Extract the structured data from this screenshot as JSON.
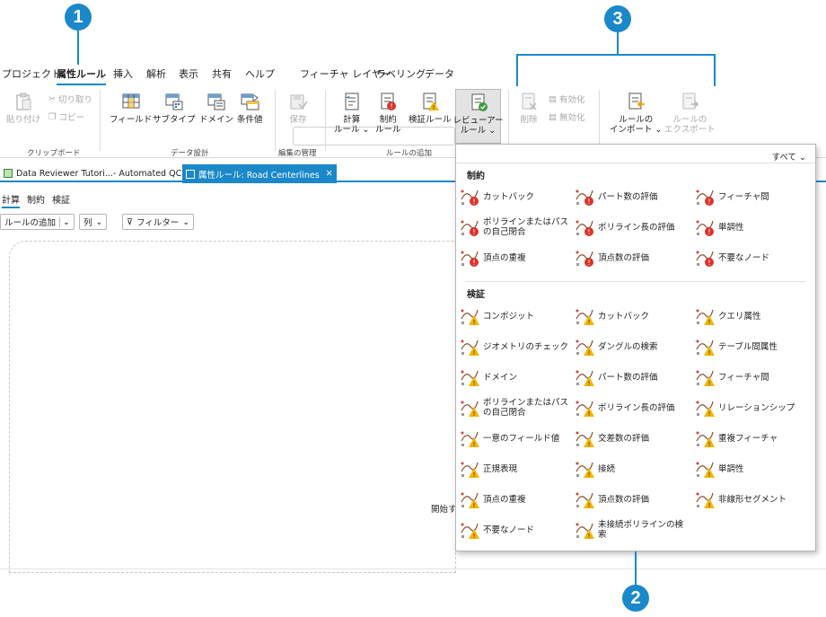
{
  "callouts": [
    "1",
    "2",
    "3"
  ],
  "menu": {
    "items": [
      "プロジェクト",
      "属性ルール",
      "挿入",
      "解析",
      "表示",
      "共有",
      "ヘルプ"
    ],
    "contextual": [
      "フィーチャ レイヤー",
      "ラベリング",
      "データ"
    ]
  },
  "ribbon": {
    "paste": "貼り付け",
    "cut": "切り取り",
    "copy": "コピー",
    "clipboard_group": "クリップボード",
    "field": "フィールド",
    "subtype": "サブタイプ",
    "domain": "ドメイン",
    "condition": "条件値",
    "data_design_group": "データ設計",
    "save": "保存",
    "edit_mgmt_group": "編集の管理",
    "calc_1": "計算",
    "calc_2": "ルール ⌄",
    "constraint_1": "制約",
    "constraint_2": "ルール",
    "validation": "検証ルール",
    "reviewer_1": "レビューアー",
    "reviewer_2": "ルール ⌄",
    "add_rule_group": "ルールの追加",
    "delete": "削除",
    "enable": "有効化",
    "disable": "無効化",
    "import_1": "ルールの",
    "import_2": "インポート ⌄",
    "export_1": "ルールの",
    "export_2": "エクスポート"
  },
  "doc_tabs": {
    "tab1": "Data Reviewer Tutori...-  Automated QC",
    "tab2": "属性ルール: Road Centerlines",
    "close": "✕"
  },
  "subtabs": [
    "計算",
    "制約",
    "検証"
  ],
  "toolbar": {
    "add_rule": "ルールの追加",
    "columns": "列",
    "filter": "フィルター"
  },
  "canvas_text": "開始す",
  "panel": {
    "filter": "すべて ⌄",
    "constraint_title": "制約",
    "validation_title": "検証",
    "constraint_items": [
      "カットバック",
      "パート数の評価",
      "フィーチャ間",
      "ポリラインまたはパスの自己閉合",
      "ポリライン長の評価",
      "単調性",
      "頂点の重複",
      "頂点数の評価",
      "不要なノード"
    ],
    "validation_items": [
      "コンポジット",
      "カットバック",
      "クエリ属性",
      "ジオメトリのチェック",
      "ダングルの検索",
      "テーブル間属性",
      "ドメイン",
      "パート数の評価",
      "フィーチャ間",
      "ポリラインまたはパスの自己閉合",
      "ポリライン長の評価",
      "リレーションシップ",
      "一意のフィールド値",
      "交差数の評価",
      "重複フィーチャ",
      "正規表現",
      "接続",
      "単調性",
      "頂点の重複",
      "頂点数の評価",
      "非線形セグメント",
      "不要なノード",
      "未接続ポリラインの検索"
    ]
  },
  "colors": {
    "accent": "#1a88c9",
    "warning": "#f5b400",
    "error": "#d9342b"
  }
}
